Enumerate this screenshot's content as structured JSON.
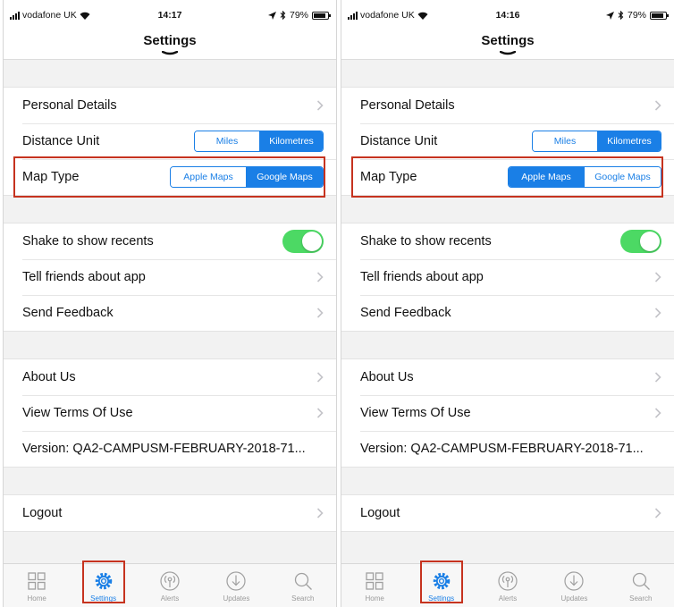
{
  "screens": [
    {
      "status": {
        "carrier": "vodafone UK",
        "time": "14:17",
        "battery": "79%"
      },
      "title": "Settings",
      "rows": {
        "personal_details": "Personal Details",
        "distance_unit": "Distance Unit",
        "distance_options": [
          "Miles",
          "Kilometres"
        ],
        "distance_selected": "Kilometres",
        "map_type": "Map Type",
        "map_options": [
          "Apple Maps",
          "Google Maps"
        ],
        "map_selected": "Google Maps",
        "shake": "Shake to show recents",
        "tell_friends": "Tell friends about app",
        "send_feedback": "Send Feedback",
        "about_us": "About Us",
        "terms": "View Terms Of Use",
        "version": "Version: QA2-CAMPUSM-FEBRUARY-2018-71...",
        "logout": "Logout"
      },
      "tabs": [
        "Home",
        "Settings",
        "Alerts",
        "Updates",
        "Search"
      ],
      "active_tab": "Settings"
    },
    {
      "status": {
        "carrier": "vodafone UK",
        "time": "14:16",
        "battery": "79%"
      },
      "title": "Settings",
      "rows": {
        "personal_details": "Personal Details",
        "distance_unit": "Distance Unit",
        "distance_options": [
          "Miles",
          "Kilometres"
        ],
        "distance_selected": "Kilometres",
        "map_type": "Map Type",
        "map_options": [
          "Apple Maps",
          "Google Maps"
        ],
        "map_selected": "Apple Maps",
        "shake": "Shake to show recents",
        "tell_friends": "Tell friends about app",
        "send_feedback": "Send Feedback",
        "about_us": "About Us",
        "terms": "View Terms Of Use",
        "version": "Version: QA2-CAMPUSM-FEBRUARY-2018-71...",
        "logout": "Logout"
      },
      "tabs": [
        "Home",
        "Settings",
        "Alerts",
        "Updates",
        "Search"
      ],
      "active_tab": "Settings"
    }
  ],
  "colors": {
    "accent": "#1a7fe6",
    "toggle_on": "#4cd964",
    "highlight_box": "#c6331f",
    "group_background": "#f2f2f2"
  },
  "icons": {
    "status": [
      "signal-icon",
      "wifi-icon",
      "location-arrow-icon",
      "bluetooth-icon",
      "battery-icon"
    ],
    "rows": "chevron-right-icon",
    "tabs": [
      "grid-icon",
      "gear-icon",
      "broadcast-icon",
      "download-icon",
      "search-icon"
    ]
  }
}
